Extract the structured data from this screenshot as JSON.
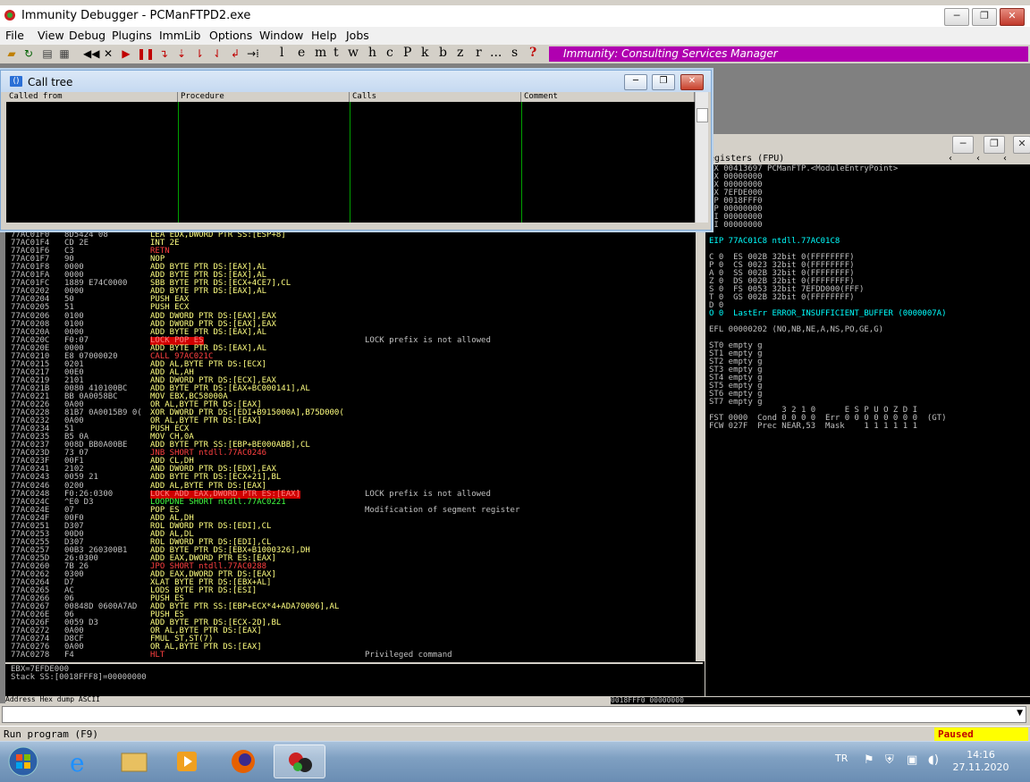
{
  "window": {
    "title": "Immunity Debugger - PCManFTPD2.exe",
    "minimize": "─",
    "restore": "❐",
    "close": "✕"
  },
  "menu": [
    "File",
    "View",
    "Debug",
    "Plugins",
    "ImmLib",
    "Options",
    "Window",
    "Help",
    "Jobs"
  ],
  "toolbar": {
    "letters": [
      "l",
      "e",
      "m",
      "t",
      "w",
      "h",
      "c",
      "P",
      "k",
      "b",
      "z",
      "r",
      "...",
      "s",
      "?"
    ],
    "banner": "Immunity: Consulting Services Manager"
  },
  "call_tree": {
    "title": "Call tree",
    "icon_text": "()",
    "columns": [
      "Called from",
      "Procedure",
      "Calls",
      "Comment"
    ]
  },
  "registers": {
    "header": "egisters (FPU)",
    "lines": [
      "AX 00413697 PCManFTP.<ModuleEntryPoint>",
      "CX 00000000",
      "DX 00000000",
      "BX 7EFDE000",
      "SP 0018FFF0",
      "BP 00000000",
      "SI 00000000",
      "DI 00000000",
      "",
      "EIP 77AC01C8 ntdll.77AC01C8",
      "",
      "C 0  ES 002B 32bit 0(FFFFFFFF)",
      "P 0  CS 0023 32bit 0(FFFFFFFF)",
      "A 0  SS 002B 32bit 0(FFFFFFFF)",
      "Z 0  DS 002B 32bit 0(FFFFFFFF)",
      "S 0  FS 0053 32bit 7EFDD000(FFF)",
      "T 0  GS 002B 32bit 0(FFFFFFFF)",
      "D 0",
      "O 0  LastErr ERROR_INSUFFICIENT_BUFFER (0000007A)",
      "",
      "EFL 00000202 (NO,NB,NE,A,NS,PO,GE,G)",
      "",
      "ST0 empty g",
      "ST1 empty g",
      "ST2 empty g",
      "ST3 empty g",
      "ST4 empty g",
      "ST5 empty g",
      "ST6 empty g",
      "ST7 empty g",
      "               3 2 1 0      E S P U O Z D I",
      "FST 0000  Cond 0 0 0 0  Err 0 0 0 0 0 0 0 0  (GT)",
      "FCW 027F  Prec NEAR,53  Mask    1 1 1 1 1 1"
    ]
  },
  "disasm": [
    {
      "a": "77AC01EC",
      "h": "8D6424 00",
      "i": "LEA ESP,DWORD PTR SS:[ESP]",
      "c": "",
      "k": "y"
    },
    {
      "a": "77AC01F0",
      "h": "8D5424 08",
      "i": "LEA EDX,DWORD PTR SS:[ESP+8]",
      "c": "",
      "k": "y"
    },
    {
      "a": "77AC01F4",
      "h": "CD 2E",
      "i": "INT 2E",
      "c": "",
      "k": "y"
    },
    {
      "a": "77AC01F6",
      "h": "C3",
      "i": "RETN",
      "c": "",
      "k": "r"
    },
    {
      "a": "77AC01F7",
      "h": "90",
      "i": "NOP",
      "c": "",
      "k": "y"
    },
    {
      "a": "77AC01F8",
      "h": "0000",
      "i": "ADD BYTE PTR DS:[EAX],AL",
      "c": "",
      "k": "y"
    },
    {
      "a": "77AC01FA",
      "h": "0000",
      "i": "ADD BYTE PTR DS:[EAX],AL",
      "c": "",
      "k": "y"
    },
    {
      "a": "77AC01FC",
      "h": "1889 E74C0000",
      "i": "SBB BYTE PTR DS:[ECX+4CE7],CL",
      "c": "",
      "k": "y"
    },
    {
      "a": "77AC0202",
      "h": "0000",
      "i": "ADD BYTE PTR DS:[EAX],AL",
      "c": "",
      "k": "y"
    },
    {
      "a": "77AC0204",
      "h": "50",
      "i": "PUSH EAX",
      "c": "",
      "k": "y"
    },
    {
      "a": "77AC0205",
      "h": "51",
      "i": "PUSH ECX",
      "c": "",
      "k": "y"
    },
    {
      "a": "77AC0206",
      "h": "0100",
      "i": "ADD DWORD PTR DS:[EAX],EAX",
      "c": "",
      "k": "y"
    },
    {
      "a": "77AC0208",
      "h": "0100",
      "i": "ADD DWORD PTR DS:[EAX],EAX",
      "c": "",
      "k": "y"
    },
    {
      "a": "77AC020A",
      "h": "0000",
      "i": "ADD BYTE PTR DS:[EAX],AL",
      "c": "",
      "k": "y"
    },
    {
      "a": "77AC020C",
      "h": "F0:07",
      "i": "LOCK POP ES",
      "c": "LOCK prefix is not allowed",
      "k": "bg"
    },
    {
      "a": "77AC020E",
      "h": "0000",
      "i": "ADD BYTE PTR DS:[EAX],AL",
      "c": "",
      "k": "y"
    },
    {
      "a": "77AC0210",
      "h": "E8 07000020",
      "i": "CALL 97AC021C",
      "c": "",
      "k": "r"
    },
    {
      "a": "77AC0215",
      "h": "0201",
      "i": "ADD AL,BYTE PTR DS:[ECX]",
      "c": "",
      "k": "y"
    },
    {
      "a": "77AC0217",
      "h": "00E0",
      "i": "ADD AL,AH",
      "c": "",
      "k": "y"
    },
    {
      "a": "77AC0219",
      "h": "2101",
      "i": "AND DWORD PTR DS:[ECX],EAX",
      "c": "",
      "k": "y"
    },
    {
      "a": "77AC021B",
      "h": "0080 410100BC",
      "i": "ADD BYTE PTR DS:[EAX+BC000141],AL",
      "c": "",
      "k": "y"
    },
    {
      "a": "77AC0221",
      "h": "BB 0A0058BC",
      "i": "MOV EBX,BC58000A",
      "c": "",
      "k": "y"
    },
    {
      "a": "77AC0226",
      "h": "0A00",
      "i": "OR AL,BYTE PTR DS:[EAX]",
      "c": "",
      "k": "y"
    },
    {
      "a": "77AC0228",
      "h": "81B7 0A0015B9 0(",
      "i": "XOR DWORD PTR DS:[EDI+B915000A],B75D000(",
      "c": "",
      "k": "y"
    },
    {
      "a": "77AC0232",
      "h": "0A00",
      "i": "OR AL,BYTE PTR DS:[EAX]",
      "c": "",
      "k": "y"
    },
    {
      "a": "77AC0234",
      "h": "51",
      "i": "PUSH ECX",
      "c": "",
      "k": "y"
    },
    {
      "a": "77AC0235",
      "h": "B5 0A",
      "i": "MOV CH,0A",
      "c": "",
      "k": "y"
    },
    {
      "a": "77AC0237",
      "h": "008D BB0A00BE",
      "i": "ADD BYTE PTR SS:[EBP+BE000ABB],CL",
      "c": "",
      "k": "y"
    },
    {
      "a": "77AC023D",
      "h": "73 07",
      "i": "JNB SHORT ntdll.77AC0246",
      "c": "",
      "k": "r"
    },
    {
      "a": "77AC023F",
      "h": "00F1",
      "i": "ADD CL,DH",
      "c": "",
      "k": "y"
    },
    {
      "a": "77AC0241",
      "h": "2102",
      "i": "AND DWORD PTR DS:[EDX],EAX",
      "c": "",
      "k": "y"
    },
    {
      "a": "77AC0243",
      "h": "0059 21",
      "i": "ADD BYTE PTR DS:[ECX+21],BL",
      "c": "",
      "k": "y"
    },
    {
      "a": "77AC0246",
      "h": "0200",
      "i": "ADD AL,BYTE PTR DS:[EAX]",
      "c": "",
      "k": "y"
    },
    {
      "a": "77AC0248",
      "h": "F0:26:0300",
      "i": "LOCK ADD EAX,DWORD PTR ES:[EAX]",
      "c": "LOCK prefix is not allowed",
      "k": "bg"
    },
    {
      "a": "77AC024C",
      "h": "^E0 D3",
      "i": "LOOPDNE SHORT ntdll.77AC0221",
      "c": "",
      "k": "g"
    },
    {
      "a": "77AC024E",
      "h": "07",
      "i": "POP ES",
      "c": "Modification of segment register",
      "k": "y"
    },
    {
      "a": "77AC024F",
      "h": "00F0",
      "i": "ADD AL,DH",
      "c": "",
      "k": "y"
    },
    {
      "a": "77AC0251",
      "h": "D307",
      "i": "ROL DWORD PTR DS:[EDI],CL",
      "c": "",
      "k": "y"
    },
    {
      "a": "77AC0253",
      "h": "00D0",
      "i": "ADD AL,DL",
      "c": "",
      "k": "y"
    },
    {
      "a": "77AC0255",
      "h": "D307",
      "i": "ROL DWORD PTR DS:[EDI],CL",
      "c": "",
      "k": "y"
    },
    {
      "a": "77AC0257",
      "h": "00B3 260300B1",
      "i": "ADD BYTE PTR DS:[EBX+B1000326],DH",
      "c": "",
      "k": "y"
    },
    {
      "a": "77AC025D",
      "h": "26:0300",
      "i": "ADD EAX,DWORD PTR ES:[EAX]",
      "c": "",
      "k": "y"
    },
    {
      "a": "77AC0260",
      "h": "7B 26",
      "i": "JPO SHORT ntdll.77AC0288",
      "c": "",
      "k": "r"
    },
    {
      "a": "77AC0262",
      "h": "0300",
      "i": "ADD EAX,DWORD PTR DS:[EAX]",
      "c": "",
      "k": "y"
    },
    {
      "a": "77AC0264",
      "h": "D7",
      "i": "XLAT BYTE PTR DS:[EBX+AL]",
      "c": "",
      "k": "y"
    },
    {
      "a": "77AC0265",
      "h": "AC",
      "i": "LODS BYTE PTR DS:[ESI]",
      "c": "",
      "k": "y"
    },
    {
      "a": "77AC0266",
      "h": "06",
      "i": "PUSH ES",
      "c": "",
      "k": "y"
    },
    {
      "a": "77AC0267",
      "h": "00848D 0600A7AD",
      "i": "ADD BYTE PTR SS:[EBP+ECX*4+ADA70006],AL",
      "c": "",
      "k": "y"
    },
    {
      "a": "77AC026E",
      "h": "06",
      "i": "PUSH ES",
      "c": "",
      "k": "y"
    },
    {
      "a": "77AC026F",
      "h": "0059 D3",
      "i": "ADD BYTE PTR DS:[ECX-2D],BL",
      "c": "",
      "k": "y"
    },
    {
      "a": "77AC0272",
      "h": "0A00",
      "i": "OR AL,BYTE PTR DS:[EAX]",
      "c": "",
      "k": "y"
    },
    {
      "a": "77AC0274",
      "h": "D8CF",
      "i": "FMUL ST,ST(7)",
      "c": "",
      "k": "y"
    },
    {
      "a": "77AC0276",
      "h": "0A00",
      "i": "OR AL,BYTE PTR DS:[EAX]",
      "c": "",
      "k": "y"
    },
    {
      "a": "77AC0278",
      "h": "F4",
      "i": "HLT",
      "c": "Privileged command",
      "k": "r"
    }
  ],
  "info_pane": [
    "EBX=7EFDE000",
    "Stack SS:[0018FFF8]=00000000"
  ],
  "dump_header": "Address   Hex dump                    ASCII",
  "stack_strip": "0018FFF0   00000000",
  "status": {
    "text": "Run program (F9)",
    "state": "Paused"
  },
  "taskbar": {
    "lang": "TR",
    "time": "14:16",
    "date": "27.11.2020"
  },
  "colors": {
    "banner": "#b000b0",
    "paused_bg": "#ffff00",
    "paused_fg": "#c00000"
  }
}
